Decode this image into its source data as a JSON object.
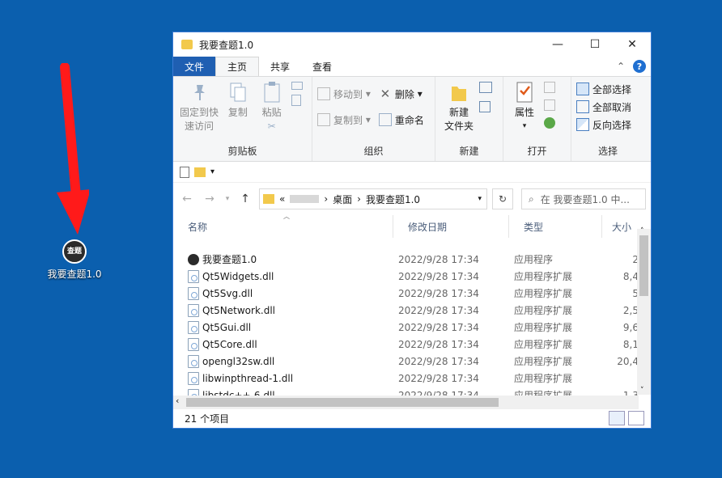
{
  "desktop": {
    "icon_label": "我要查题1.0",
    "icon_badge": "查题"
  },
  "window": {
    "title": "我要查题1.0",
    "controls": {
      "minimize": "—",
      "maximize": "☐",
      "close": "✕"
    }
  },
  "tabs": [
    {
      "label": "文件"
    },
    {
      "label": "主页"
    },
    {
      "label": "共享"
    },
    {
      "label": "查看"
    }
  ],
  "ribbon": {
    "clipboard": {
      "name": "剪贴板",
      "pin": "固定到快速访问",
      "copy": "复制",
      "paste": "粘贴"
    },
    "organize": {
      "name": "组织",
      "move_to": "移动到",
      "copy_to": "复制到",
      "delete": "删除",
      "rename": "重命名"
    },
    "new": {
      "name": "新建",
      "new_folder": "新建\n文件夹"
    },
    "open": {
      "name": "打开",
      "properties": "属性"
    },
    "select": {
      "name": "选择",
      "select_all": "全部选择",
      "select_none": "全部取消",
      "invert": "反向选择"
    }
  },
  "address": {
    "prefix": "«",
    "crumbs": [
      "桌面",
      "我要查题1.0"
    ],
    "search_placeholder": "在 我要查题1.0 中..."
  },
  "columns": {
    "name": "名称",
    "date": "修改日期",
    "type": "类型",
    "size": "大小"
  },
  "files": [
    {
      "name": "我要查题1.0",
      "date": "2022/9/28 17:34",
      "type": "应用程序",
      "size": "2",
      "app": true
    },
    {
      "name": "Qt5Widgets.dll",
      "date": "2022/9/28 17:34",
      "type": "应用程序扩展",
      "size": "8,4"
    },
    {
      "name": "Qt5Svg.dll",
      "date": "2022/9/28 17:34",
      "type": "应用程序扩展",
      "size": "5"
    },
    {
      "name": "Qt5Network.dll",
      "date": "2022/9/28 17:34",
      "type": "应用程序扩展",
      "size": "2,5"
    },
    {
      "name": "Qt5Gui.dll",
      "date": "2022/9/28 17:34",
      "type": "应用程序扩展",
      "size": "9,6"
    },
    {
      "name": "Qt5Core.dll",
      "date": "2022/9/28 17:34",
      "type": "应用程序扩展",
      "size": "8,1"
    },
    {
      "name": "opengl32sw.dll",
      "date": "2022/9/28 17:34",
      "type": "应用程序扩展",
      "size": "20,4"
    },
    {
      "name": "libwinpthread-1.dll",
      "date": "2022/9/28 17:34",
      "type": "应用程序扩展",
      "size": ""
    },
    {
      "name": "libstdc++-6.dll",
      "date": "2022/9/28 17:34",
      "type": "应用程序扩展",
      "size": "1,3"
    }
  ],
  "status": {
    "count": "21 个项目"
  },
  "colors": {
    "desktop": "#0b5fae",
    "file_tab": "#1f5fb2",
    "arrow": "#ff1a1a"
  }
}
